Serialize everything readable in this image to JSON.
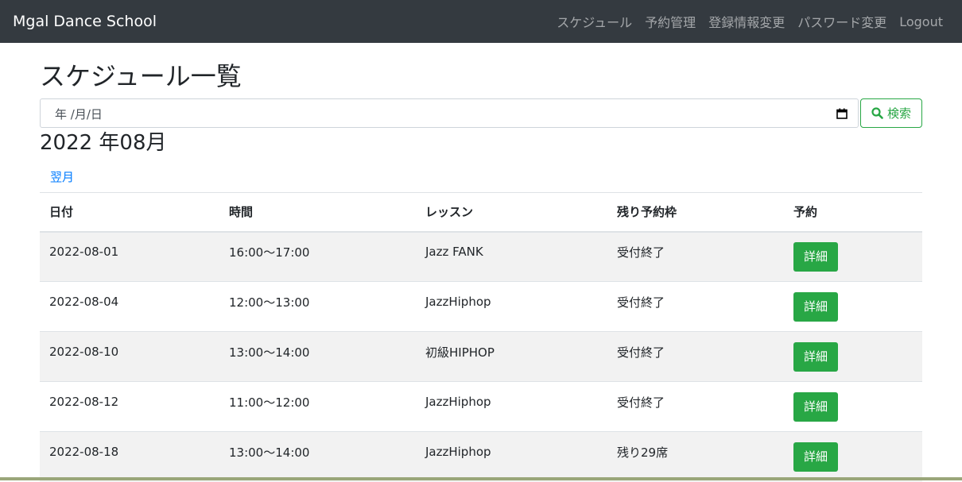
{
  "navbar": {
    "brand": "Mgal Dance School",
    "links": [
      "スケジュール",
      "予約管理",
      "登録情報変更",
      "パスワード変更",
      "Logout"
    ]
  },
  "page_title": "スケジュール一覧",
  "date_input": {
    "display": "年 /月/日",
    "icon": "calendar-icon"
  },
  "search_button": {
    "label": "検索",
    "icon": "search-icon"
  },
  "month_heading": "2022 年08月",
  "next_month_link": "翌月",
  "table": {
    "headers": [
      "日付",
      "時間",
      "レッスン",
      "残り予約枠",
      "予約"
    ],
    "rows": [
      {
        "date": "2022-08-01",
        "time": "16:00〜17:00",
        "lesson": "Jazz FANK",
        "remaining": "受付終了",
        "action": "詳細"
      },
      {
        "date": "2022-08-04",
        "time": "12:00〜13:00",
        "lesson": "JazzHiphop",
        "remaining": "受付終了",
        "action": "詳細"
      },
      {
        "date": "2022-08-10",
        "time": "13:00〜14:00",
        "lesson": "初級HIPHOP",
        "remaining": "受付終了",
        "action": "詳細"
      },
      {
        "date": "2022-08-12",
        "time": "11:00〜12:00",
        "lesson": "JazzHiphop",
        "remaining": "受付終了",
        "action": "詳細"
      },
      {
        "date": "2022-08-18",
        "time": "13:00〜14:00",
        "lesson": "JazzHiphop",
        "remaining": "残り29席",
        "action": "詳細"
      }
    ]
  },
  "colors": {
    "navbar_bg": "#343a40",
    "success": "#28a745",
    "link": "#007bff"
  }
}
